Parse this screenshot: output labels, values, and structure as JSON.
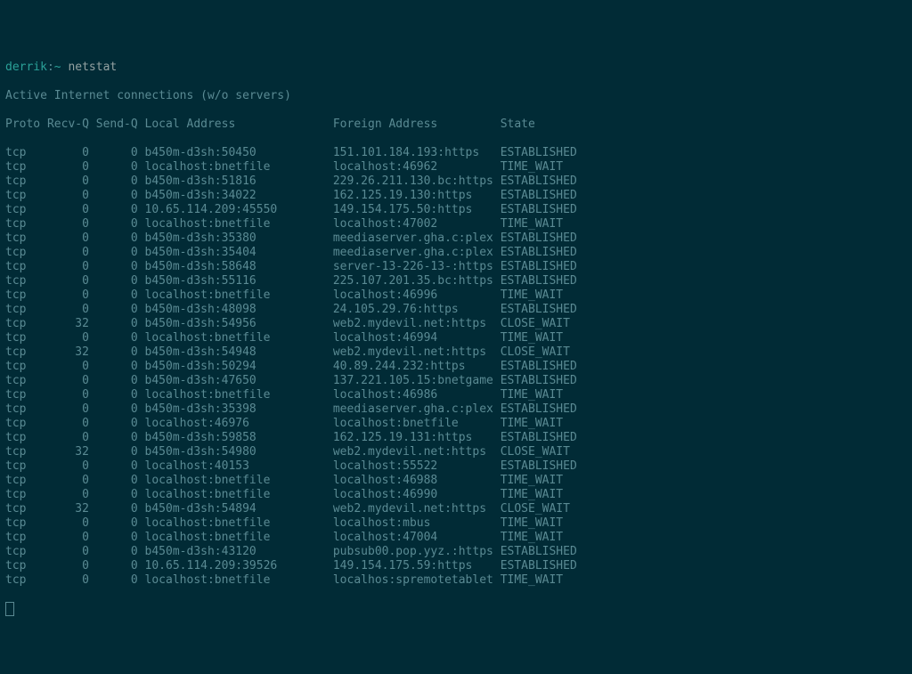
{
  "prompt": {
    "user": "derrik",
    "separator": ":",
    "path": "~",
    "command": "netstat"
  },
  "header1": "Active Internet connections (w/o servers)",
  "columns": {
    "proto": "Proto",
    "recvq": "Recv-Q",
    "sendq": "Send-Q",
    "local": "Local Address",
    "foreign": "Foreign Address",
    "state": "State"
  },
  "rows": [
    {
      "proto": "tcp",
      "recvq": "0",
      "sendq": "0",
      "local": "b450m-d3sh:50450",
      "foreign": "151.101.184.193:https",
      "state": "ESTABLISHED"
    },
    {
      "proto": "tcp",
      "recvq": "0",
      "sendq": "0",
      "local": "localhost:bnetfile",
      "foreign": "localhost:46962",
      "state": "TIME_WAIT"
    },
    {
      "proto": "tcp",
      "recvq": "0",
      "sendq": "0",
      "local": "b450m-d3sh:51816",
      "foreign": "229.26.211.130.bc:https",
      "state": "ESTABLISHED"
    },
    {
      "proto": "tcp",
      "recvq": "0",
      "sendq": "0",
      "local": "b450m-d3sh:34022",
      "foreign": "162.125.19.130:https",
      "state": "ESTABLISHED"
    },
    {
      "proto": "tcp",
      "recvq": "0",
      "sendq": "0",
      "local": "10.65.114.209:45550",
      "foreign": "149.154.175.50:https",
      "state": "ESTABLISHED"
    },
    {
      "proto": "tcp",
      "recvq": "0",
      "sendq": "0",
      "local": "localhost:bnetfile",
      "foreign": "localhost:47002",
      "state": "TIME_WAIT"
    },
    {
      "proto": "tcp",
      "recvq": "0",
      "sendq": "0",
      "local": "b450m-d3sh:35380",
      "foreign": "meediaserver.gha.c:plex",
      "state": "ESTABLISHED"
    },
    {
      "proto": "tcp",
      "recvq": "0",
      "sendq": "0",
      "local": "b450m-d3sh:35404",
      "foreign": "meediaserver.gha.c:plex",
      "state": "ESTABLISHED"
    },
    {
      "proto": "tcp",
      "recvq": "0",
      "sendq": "0",
      "local": "b450m-d3sh:58648",
      "foreign": "server-13-226-13-:https",
      "state": "ESTABLISHED"
    },
    {
      "proto": "tcp",
      "recvq": "0",
      "sendq": "0",
      "local": "b450m-d3sh:55116",
      "foreign": "225.107.201.35.bc:https",
      "state": "ESTABLISHED"
    },
    {
      "proto": "tcp",
      "recvq": "0",
      "sendq": "0",
      "local": "localhost:bnetfile",
      "foreign": "localhost:46996",
      "state": "TIME_WAIT"
    },
    {
      "proto": "tcp",
      "recvq": "0",
      "sendq": "0",
      "local": "b450m-d3sh:48098",
      "foreign": "24.105.29.76:https",
      "state": "ESTABLISHED"
    },
    {
      "proto": "tcp",
      "recvq": "32",
      "sendq": "0",
      "local": "b450m-d3sh:54956",
      "foreign": "web2.mydevil.net:https",
      "state": "CLOSE_WAIT"
    },
    {
      "proto": "tcp",
      "recvq": "0",
      "sendq": "0",
      "local": "localhost:bnetfile",
      "foreign": "localhost:46994",
      "state": "TIME_WAIT"
    },
    {
      "proto": "tcp",
      "recvq": "32",
      "sendq": "0",
      "local": "b450m-d3sh:54948",
      "foreign": "web2.mydevil.net:https",
      "state": "CLOSE_WAIT"
    },
    {
      "proto": "tcp",
      "recvq": "0",
      "sendq": "0",
      "local": "b450m-d3sh:50294",
      "foreign": "40.89.244.232:https",
      "state": "ESTABLISHED"
    },
    {
      "proto": "tcp",
      "recvq": "0",
      "sendq": "0",
      "local": "b450m-d3sh:47650",
      "foreign": "137.221.105.15:bnetgame",
      "state": "ESTABLISHED"
    },
    {
      "proto": "tcp",
      "recvq": "0",
      "sendq": "0",
      "local": "localhost:bnetfile",
      "foreign": "localhost:46986",
      "state": "TIME_WAIT"
    },
    {
      "proto": "tcp",
      "recvq": "0",
      "sendq": "0",
      "local": "b450m-d3sh:35398",
      "foreign": "meediaserver.gha.c:plex",
      "state": "ESTABLISHED"
    },
    {
      "proto": "tcp",
      "recvq": "0",
      "sendq": "0",
      "local": "localhost:46976",
      "foreign": "localhost:bnetfile",
      "state": "TIME_WAIT"
    },
    {
      "proto": "tcp",
      "recvq": "0",
      "sendq": "0",
      "local": "b450m-d3sh:59858",
      "foreign": "162.125.19.131:https",
      "state": "ESTABLISHED"
    },
    {
      "proto": "tcp",
      "recvq": "32",
      "sendq": "0",
      "local": "b450m-d3sh:54980",
      "foreign": "web2.mydevil.net:https",
      "state": "CLOSE_WAIT"
    },
    {
      "proto": "tcp",
      "recvq": "0",
      "sendq": "0",
      "local": "localhost:40153",
      "foreign": "localhost:55522",
      "state": "ESTABLISHED"
    },
    {
      "proto": "tcp",
      "recvq": "0",
      "sendq": "0",
      "local": "localhost:bnetfile",
      "foreign": "localhost:46988",
      "state": "TIME_WAIT"
    },
    {
      "proto": "tcp",
      "recvq": "0",
      "sendq": "0",
      "local": "localhost:bnetfile",
      "foreign": "localhost:46990",
      "state": "TIME_WAIT"
    },
    {
      "proto": "tcp",
      "recvq": "32",
      "sendq": "0",
      "local": "b450m-d3sh:54894",
      "foreign": "web2.mydevil.net:https",
      "state": "CLOSE_WAIT"
    },
    {
      "proto": "tcp",
      "recvq": "0",
      "sendq": "0",
      "local": "localhost:bnetfile",
      "foreign": "localhost:mbus",
      "state": "TIME_WAIT"
    },
    {
      "proto": "tcp",
      "recvq": "0",
      "sendq": "0",
      "local": "localhost:bnetfile",
      "foreign": "localhost:47004",
      "state": "TIME_WAIT"
    },
    {
      "proto": "tcp",
      "recvq": "0",
      "sendq": "0",
      "local": "b450m-d3sh:43120",
      "foreign": "pubsub00.pop.yyz.:https",
      "state": "ESTABLISHED"
    },
    {
      "proto": "tcp",
      "recvq": "0",
      "sendq": "0",
      "local": "10.65.114.209:39526",
      "foreign": "149.154.175.59:https",
      "state": "ESTABLISHED"
    },
    {
      "proto": "tcp",
      "recvq": "0",
      "sendq": "0",
      "local": "localhost:bnetfile",
      "foreign": "localhos:spremotetablet",
      "state": "TIME_WAIT"
    }
  ]
}
